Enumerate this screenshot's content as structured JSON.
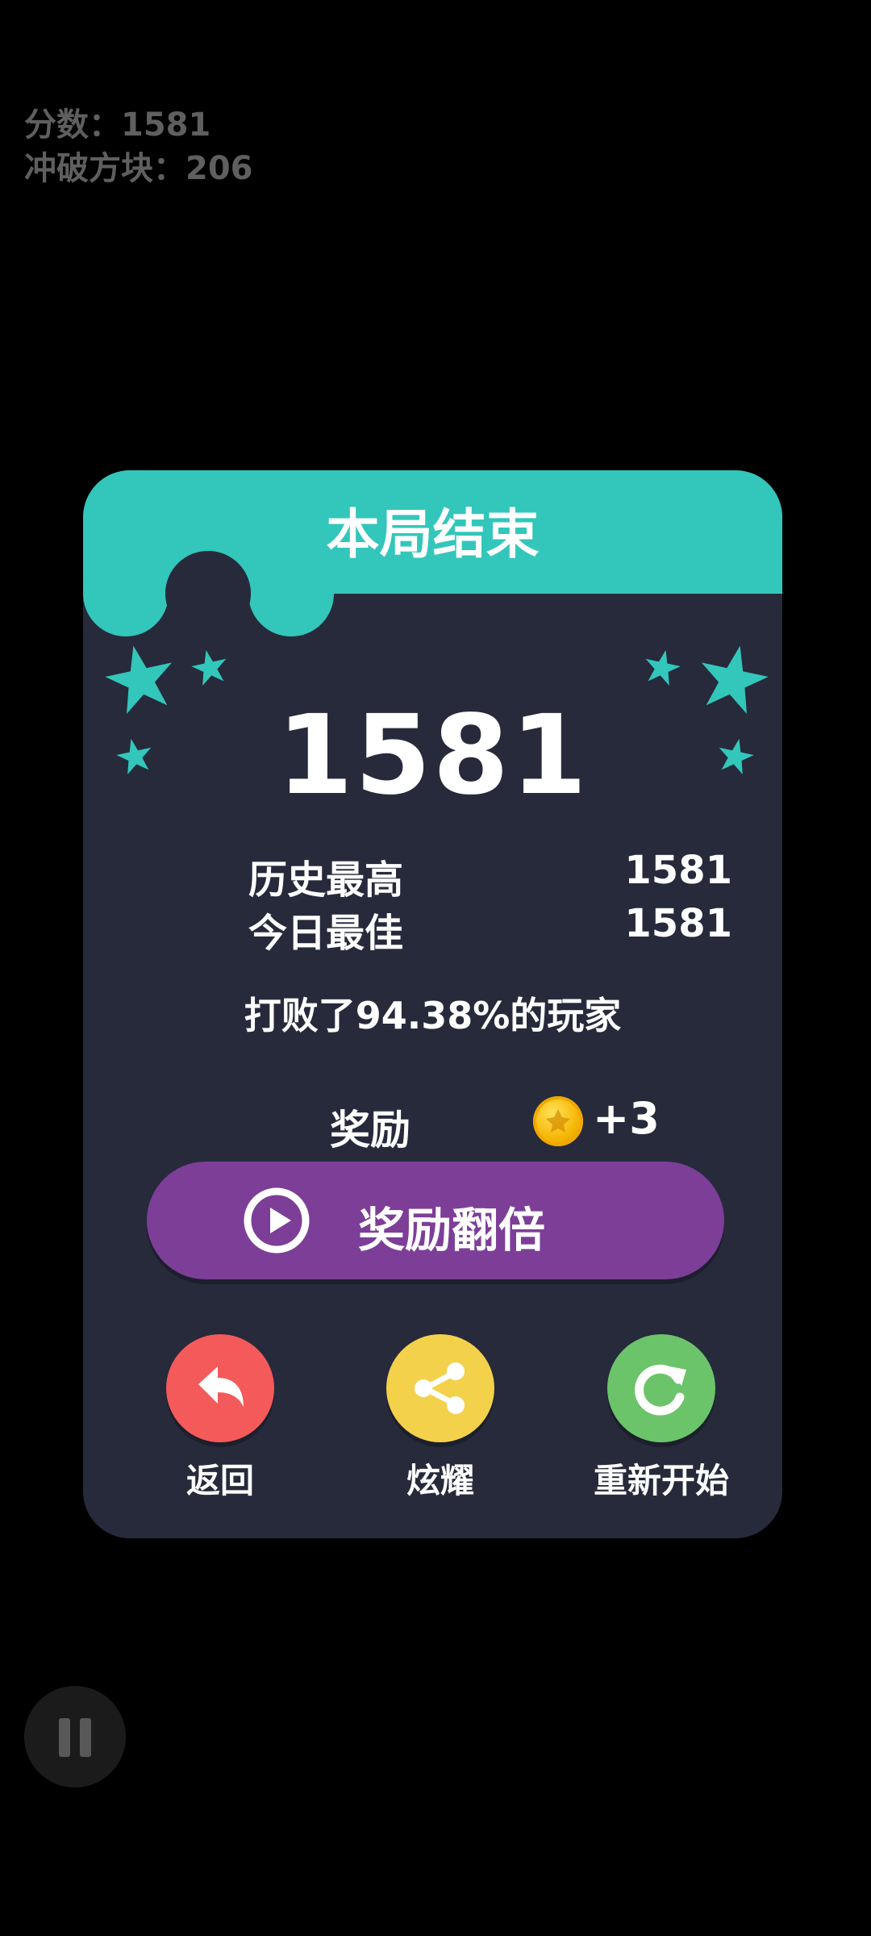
{
  "hud": {
    "score_label": "分数：",
    "score_value": "1581",
    "blocks_label": "冲破方块：",
    "blocks_value": "206"
  },
  "dialog": {
    "title": "本局结束",
    "score": "1581",
    "stats": [
      {
        "label": "历史最高",
        "value": "1581"
      },
      {
        "label": "今日最佳",
        "value": "1581"
      }
    ],
    "beat_text": "打败了94.38%的玩家",
    "reward_label": "奖励",
    "reward_amount": "+3",
    "double_button": "奖励翻倍",
    "actions": [
      {
        "label": "返回",
        "color": "#f45a5a",
        "icon": "undo-arrow-icon"
      },
      {
        "label": "炫耀",
        "color": "#f4d14b",
        "icon": "share-icon"
      },
      {
        "label": "重新开始",
        "color": "#6cc46a",
        "icon": "restart-icon"
      }
    ]
  },
  "colors": {
    "header": "#33c6bb",
    "panel": "#262a3b",
    "double_button": "#7d3e98"
  },
  "icons": [
    "star-icon",
    "coin-icon",
    "play-icon",
    "pause-icon"
  ]
}
